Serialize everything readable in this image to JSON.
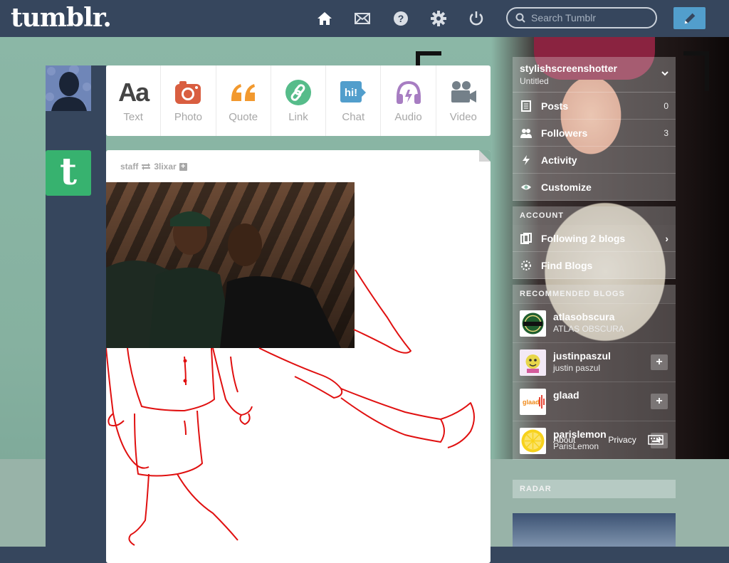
{
  "header": {
    "logo": "tumblr.",
    "nav": [
      {
        "name": "home-icon"
      },
      {
        "name": "mail-icon"
      },
      {
        "name": "help-icon"
      },
      {
        "name": "gear-icon"
      },
      {
        "name": "power-icon"
      }
    ],
    "search": {
      "placeholder": "Search Tumblr",
      "value": ""
    },
    "compose_icon": "pencil-icon"
  },
  "post_types": [
    {
      "label": "Text",
      "glyph": "Aa",
      "icon": "text-icon",
      "color": "#444444"
    },
    {
      "label": "Photo",
      "icon": "camera-icon",
      "color": "#d95e40"
    },
    {
      "label": "Quote",
      "icon": "quote-icon",
      "color": "#f2992e"
    },
    {
      "label": "Link",
      "icon": "link-icon",
      "color": "#56bc8a"
    },
    {
      "label": "Chat",
      "glyph": "hi!",
      "icon": "chat-icon",
      "color": "#529ecc"
    },
    {
      "label": "Audio",
      "icon": "headphones-icon",
      "color": "#a77dc2"
    },
    {
      "label": "Video",
      "icon": "video-camera-icon",
      "color": "#748089"
    }
  ],
  "post": {
    "author": "staff",
    "reblogged_from": "3lixar",
    "reblog_icon": "reblog-icon"
  },
  "sidebar": {
    "blog_name": "stylishscreenshotter",
    "blog_subtitle": "Untitled",
    "rows": [
      {
        "label": "Posts",
        "count": "0",
        "icon": "posts-icon"
      },
      {
        "label": "Followers",
        "count": "3",
        "icon": "followers-icon"
      },
      {
        "label": "Activity",
        "count": "",
        "icon": "activity-icon"
      },
      {
        "label": "Customize",
        "count": "",
        "icon": "eye-icon"
      }
    ],
    "account_title": "ACCOUNT",
    "account_rows": [
      {
        "label": "Following 2 blogs",
        "icon": "following-icon"
      },
      {
        "label": "Find Blogs",
        "icon": "find-blogs-icon"
      }
    ],
    "recommended_title": "RECOMMENDED BLOGS",
    "recommended": [
      {
        "name": "atlasobscura",
        "subtitle": "ATLAS OBSCURA"
      },
      {
        "name": "justinpaszul",
        "subtitle": "justin paszul"
      },
      {
        "name": "glaad",
        "subtitle": ""
      },
      {
        "name": "parislemon",
        "subtitle": "ParisLemon"
      }
    ],
    "footer": {
      "about": "About",
      "privacy": "Privacy"
    },
    "radar_title": "RADAR"
  },
  "colors": {
    "navy": "#36465d",
    "accent_blue": "#529ecc",
    "teal_bg": "#8bb7a6",
    "drawing_red": "#e01010"
  }
}
